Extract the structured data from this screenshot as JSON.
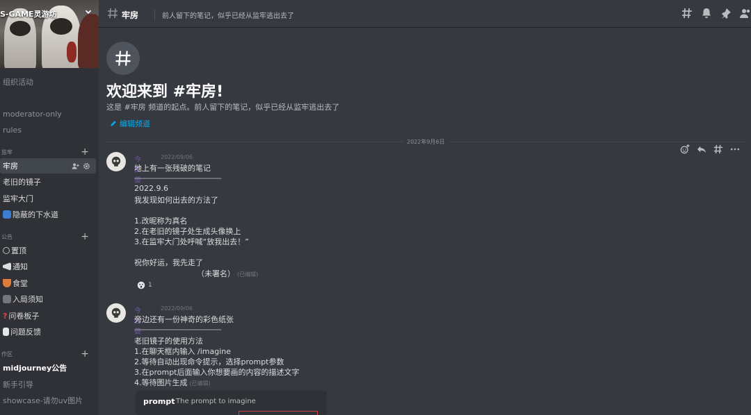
{
  "server": {
    "name": "S-GAME灵游坊",
    "top_item": "组织活动"
  },
  "sidebar": {
    "items_top": [
      {
        "label": "moderator-only"
      },
      {
        "label": "rules"
      }
    ],
    "category_1": {
      "label": "监牢"
    },
    "channels_1": [
      {
        "label": "牢房",
        "active": true
      },
      {
        "label": "老旧的镜子"
      },
      {
        "label": "监牢大门"
      },
      {
        "label": "隐蔽的下水道"
      }
    ],
    "category_2": {
      "label": "公告"
    },
    "channels_2": [
      {
        "label": "置顶"
      },
      {
        "label": "通知"
      },
      {
        "label": "食堂"
      },
      {
        "label": "入局须知"
      },
      {
        "label": "问卷板子"
      },
      {
        "label": "问题反馈"
      }
    ],
    "category_3": {
      "label": "作区"
    },
    "channels_3": [
      {
        "label": "midjourney公告"
      },
      {
        "label": "新手引导"
      },
      {
        "label": "showcase-请勿uv图片"
      }
    ]
  },
  "topbar": {
    "channel": "牢房",
    "topic": "前人留下的笔记，似乎已经从监牢逃出去了"
  },
  "welcome": {
    "title": "欢迎来到 #牢房!",
    "subtitle": "这是 #牢房 频道的起点。前人留下的笔记，似乎已经从监牢逃出去了",
    "edit_link": "编辑频道"
  },
  "date_divider": "2022年9月6日",
  "messages": [
    {
      "author": "今四兽",
      "time": "2022/09/06",
      "lines": [
        "地上有一张残破的笔记",
        "------------------------------------------",
        "2022.9.6",
        "我发现如何出去的方法了",
        "",
        "1.改昵称为真名",
        "2.在老旧的镜子处生成头像换上",
        "3.在监牢大门处呼喊“放我出去！”",
        "",
        "祝你好运，我先走了",
        "（未署名）"
      ],
      "edited": "(已编辑)",
      "reaction_count": "1"
    },
    {
      "author": "今四兽",
      "time": "2022/09/06",
      "lines": [
        "旁边还有一份神奇的彩色纸张",
        "------------------------------------------",
        "老旧镜子的使用方法",
        "1.在聊天框内输入 /imagine",
        "2.等待自动出现命令提示，选择prompt参数",
        "3.在prompt后面输入你想要画的内容的描述文字",
        "4.等待图片生成"
      ],
      "edited": "(已编辑)"
    }
  ],
  "command_hint": {
    "name": "prompt",
    "description": "The prompt to imagine"
  }
}
